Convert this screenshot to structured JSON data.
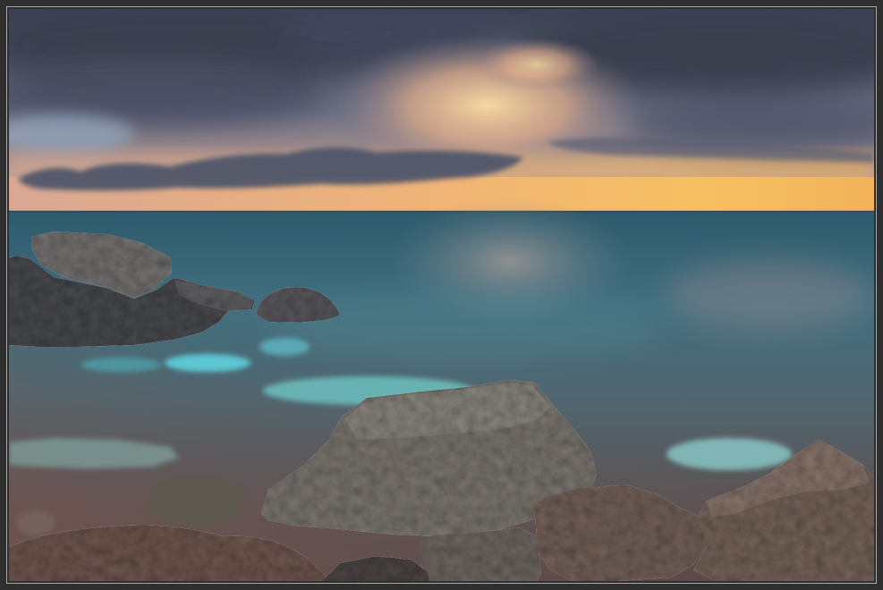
{
  "palette": {
    "frame": "#2f2f2f",
    "frame_line": "#a9a9a9",
    "sky_top": "#3c4153",
    "sky_mid": "#6a6e82",
    "sky_low": "#b89a92",
    "horizon_glow": "#eeb068",
    "cloud_dark": "#3a3f50",
    "cloud_band": "#4c5468",
    "cloud_light": "#93a5bd",
    "sun_gap": "#f7d9a0",
    "horizon_left": "#d8a894",
    "horizon_center": "#eeb27a",
    "horizon_right": "#f6c062",
    "sea_far": "#2d5a6c",
    "sea_mid": "#416f7f",
    "sea_near": "#506670",
    "shallows": "#5d5252",
    "shore_water": "#544644",
    "reflection": "#c9aca0",
    "turquoise": "#5cc6d2",
    "turquoise_pale": "#8ccaca",
    "rock_light": "#8a857e",
    "rock_gray": "#76716b",
    "rock_dark": "#46474b",
    "rock_brown": "#6e5d55",
    "rock_reddish": "#6a534c"
  }
}
